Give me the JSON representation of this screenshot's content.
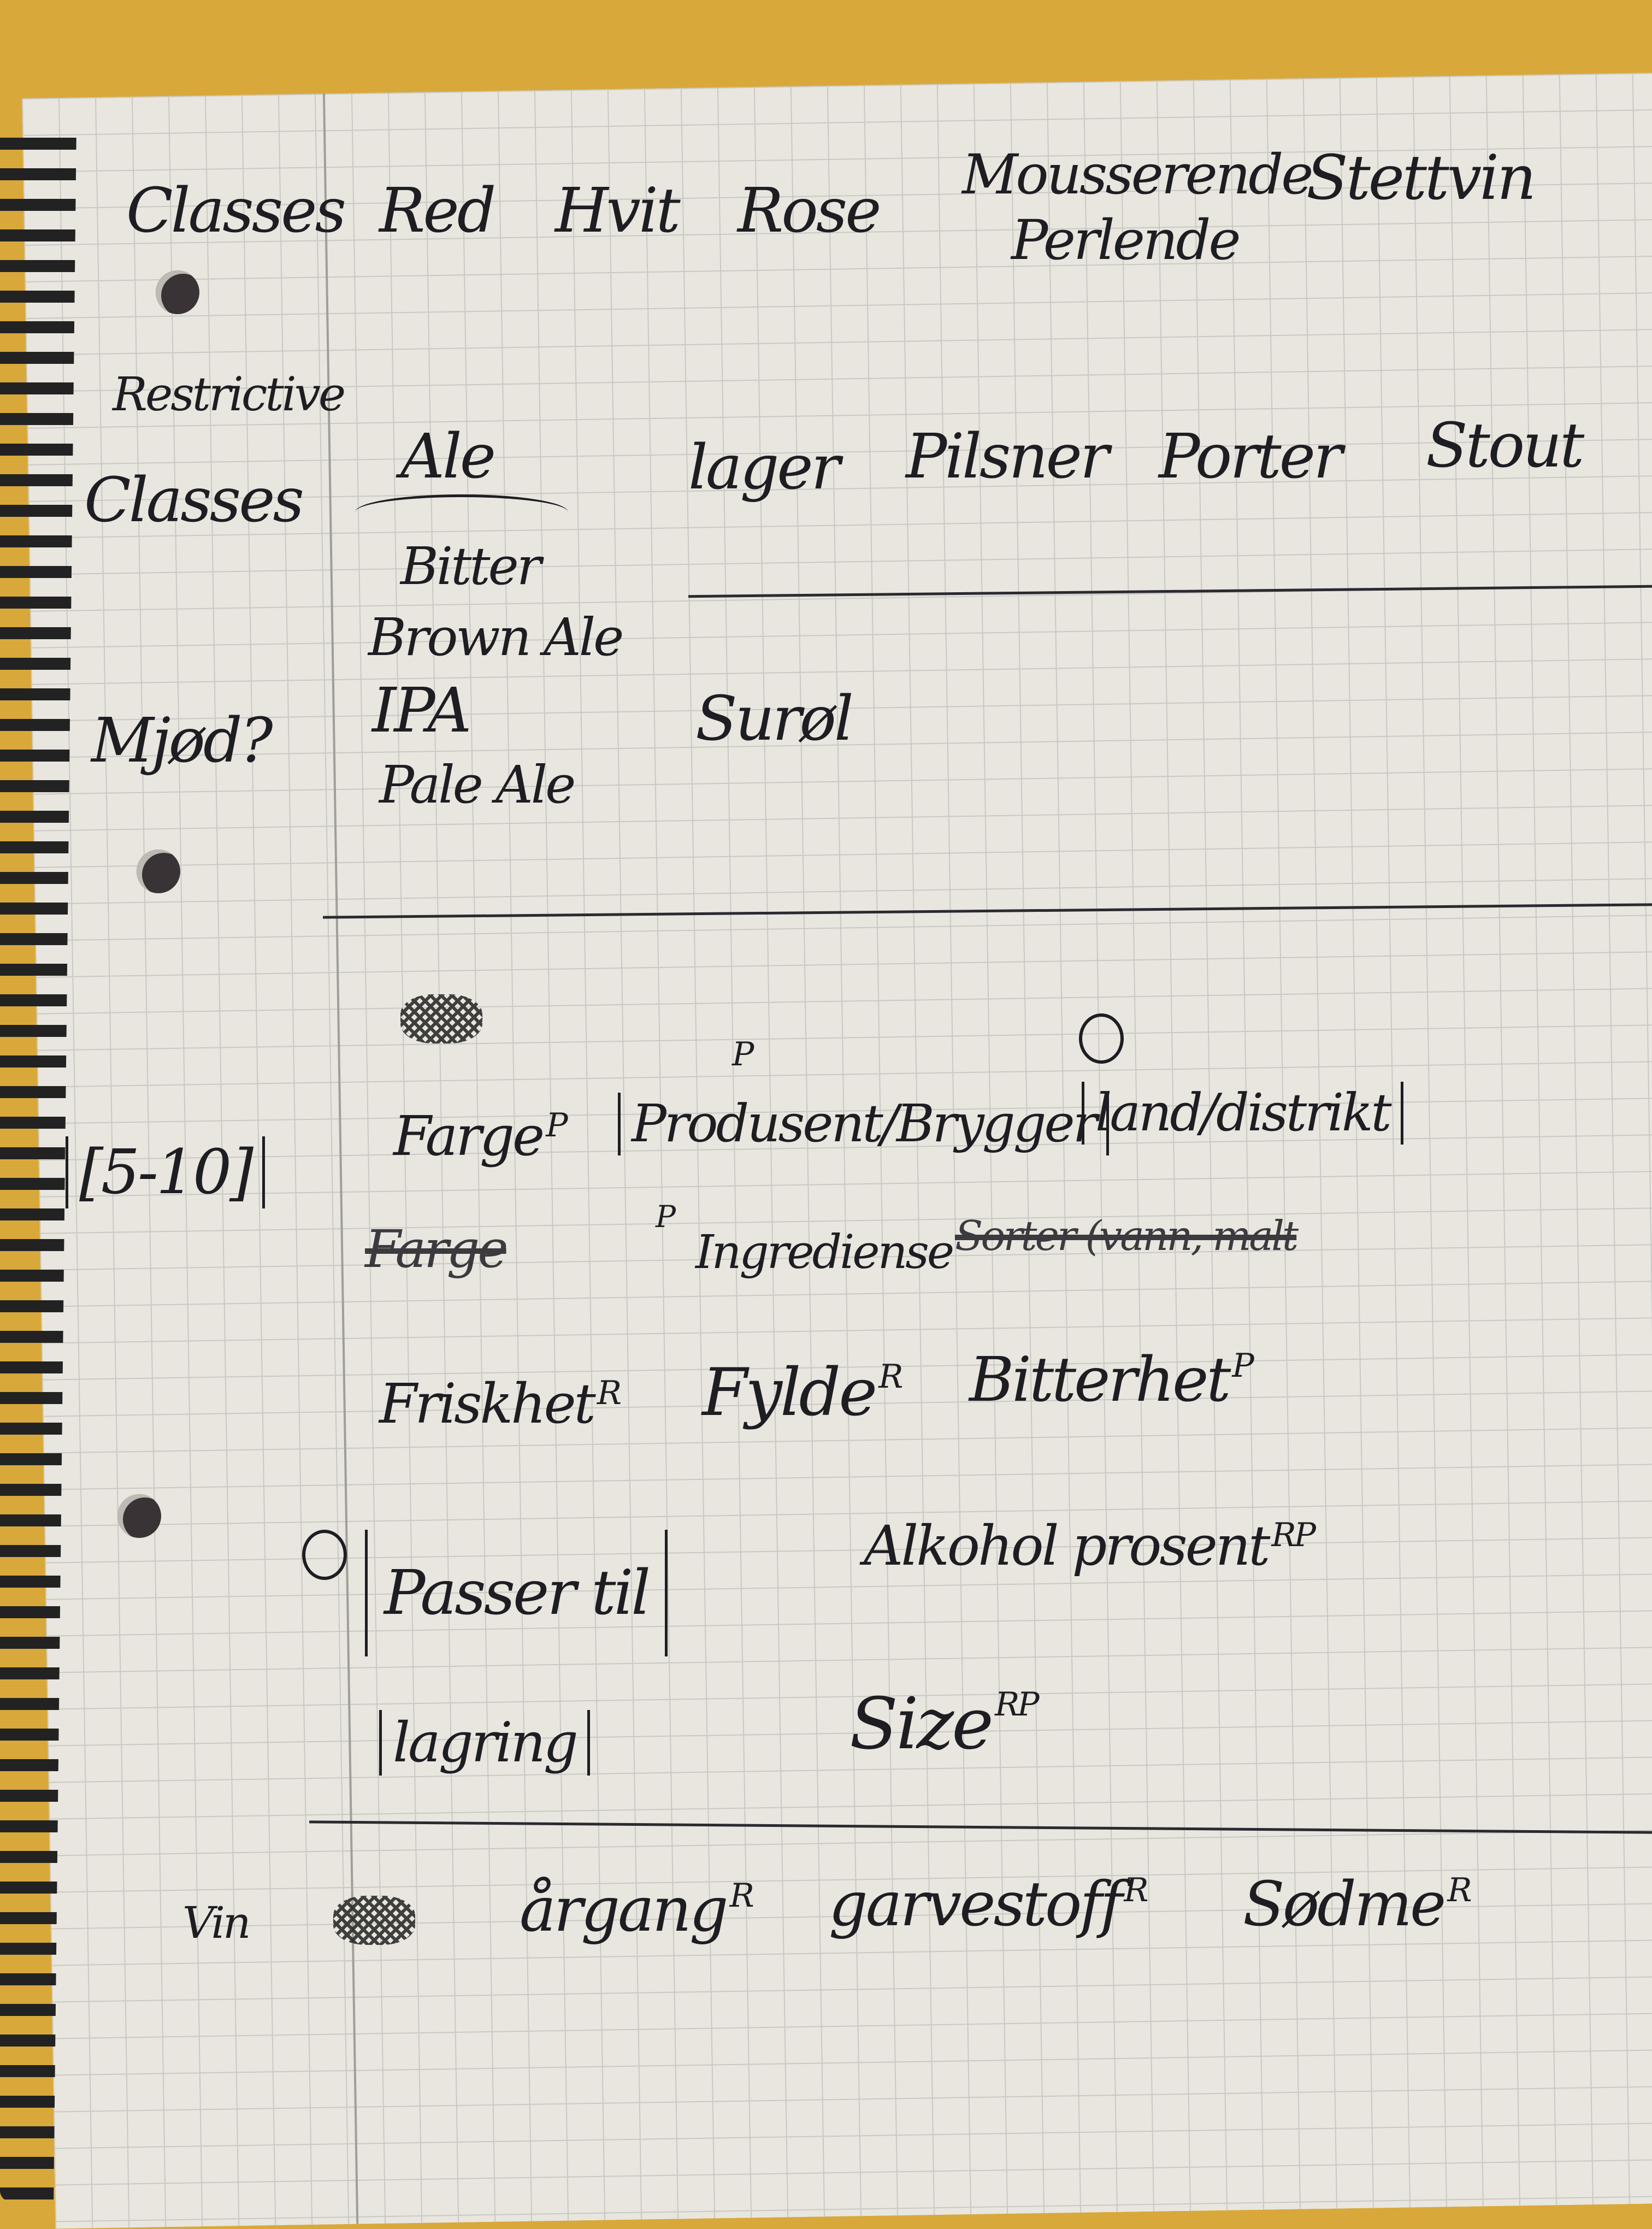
{
  "header_row": {
    "label": "Classes",
    "items": [
      "Red",
      "Hvit",
      "Rose",
      "Mousserende",
      "Perlende",
      "Stettvin"
    ]
  },
  "restrictive": {
    "label_line1": "Restrictive",
    "label_line2": "Classes",
    "ale": "Ale",
    "ale_types": [
      "Bitter",
      "Brown Ale",
      "IPA",
      "Pale Ale"
    ],
    "others": [
      "lager",
      "Pilsner",
      "Porter",
      "Stout"
    ],
    "mjod": "Mjød?",
    "surol": "Surøl"
  },
  "attributes": {
    "range": "[5-10]",
    "farge": "Farge",
    "farge_tag": "P",
    "produsent": "Produsent/Brygger",
    "produsent_tag": "P",
    "land": "land/distrikt",
    "farge_struck": "Farge",
    "ingrediense": "Ingrediense",
    "ingrediense_tag": "P",
    "struck_note": "Sorter (vann, malt",
    "friskhet": "Friskhet",
    "friskhet_tag": "R",
    "fylde": "Fylde",
    "fylde_tag": "R",
    "bitterhet": "Bitterhet",
    "bitterhet_tag": "P",
    "passer": "Passer til",
    "alkohol": "Alkohol prosent",
    "alkohol_tag": "RP",
    "lagring": "lagring",
    "size": "Size",
    "size_tag": "RP"
  },
  "wine_row": {
    "label": "Vin",
    "items": [
      {
        "text": "årgang",
        "tag": "R"
      },
      {
        "text": "garvestoff",
        "tag": "R"
      },
      {
        "text": "Sødme",
        "tag": "R"
      }
    ]
  }
}
